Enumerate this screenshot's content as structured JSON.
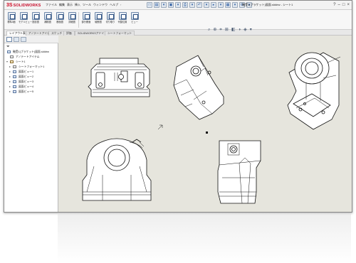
{
  "app": {
    "name": "SOLIDWORKS",
    "ds_mark": "3S",
    "menus": [
      "ファイル",
      "編集",
      "表示",
      "挿入",
      "ツール",
      "ウィンドウ",
      "ヘルプ"
    ],
    "pin": "›",
    "document_title": "軸受1(ブラケット)図面.slddrw - シート1",
    "window_buttons": [
      "?",
      "–",
      "□",
      "×"
    ],
    "quick_icons": [
      "□",
      "▤",
      "▾",
      "▣",
      "▾",
      "⎙",
      "▾",
      "↶",
      "▾",
      "▸",
      "▾",
      "▦",
      "▾",
      "⚙",
      "▾"
    ]
  },
  "ribbon": {
    "buttons": [
      {
        "label": "標準3面"
      },
      {
        "label": "モデルビュー"
      },
      {
        "label": "投影図"
      },
      {
        "label": "補助図"
      },
      {
        "label": "断面図"
      },
      {
        "label": "詳細図"
      },
      {
        "label": "部分断面"
      },
      {
        "label": "破断図"
      },
      {
        "label": "切り取り"
      },
      {
        "label": "代替位置"
      },
      {
        "label": "ビュー"
      }
    ]
  },
  "tabs": [
    {
      "label": "レイアウト表示"
    },
    {
      "label": "アノテートアイテム"
    },
    {
      "label": "スケッチ"
    },
    {
      "label": "評価"
    },
    {
      "label": "SOLIDWORKSアドイン"
    },
    {
      "label": "シートフォーマット"
    }
  ],
  "hud": {
    "icons": [
      "⌕",
      "⊕",
      "⌗",
      "⊞",
      "◧",
      "◑",
      "◈",
      "▾"
    ]
  },
  "feature_tree": {
    "filter_icon": "filter-icon",
    "items": [
      {
        "label": "軸受1(ブラケット)図面.slddrw",
        "level": 0,
        "expanded": ""
      },
      {
        "label": "アノテートアイテム",
        "level": 1,
        "expanded": ""
      },
      {
        "label": "シート1",
        "level": 1,
        "expanded": "▾"
      },
      {
        "label": "シートフォーマット1",
        "level": 2,
        "expanded": "▸"
      },
      {
        "label": "図面ビュー1",
        "level": 2,
        "expanded": "▸"
      },
      {
        "label": "図面ビュー2",
        "level": 2,
        "expanded": "▸"
      },
      {
        "label": "図面ビュー3",
        "level": 2,
        "expanded": "▸"
      },
      {
        "label": "図面ビュー4",
        "level": 2,
        "expanded": "▸"
      },
      {
        "label": "図面ビュー5",
        "level": 2,
        "expanded": "▸"
      }
    ]
  },
  "colors": {
    "brand": "#c8102e",
    "canvas": "#e6e5dd",
    "accent": "#2c4f80"
  }
}
